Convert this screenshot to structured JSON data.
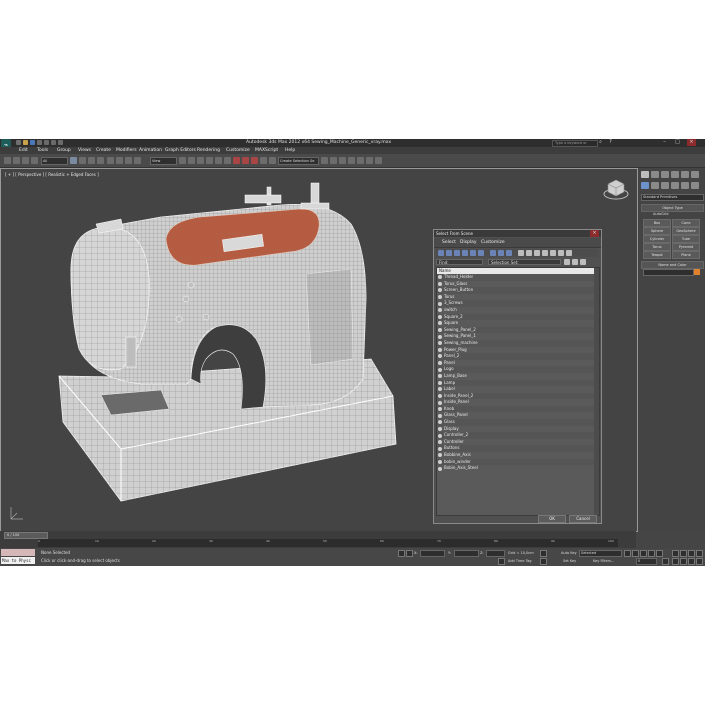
{
  "app": {
    "title": "Autodesk 3ds Max  2012 x64     Sewing_Machine_Generic_vray.max",
    "search_placeholder": "Type a keyword or phrase"
  },
  "menu": [
    "Edit",
    "Tools",
    "Group",
    "Views",
    "Create",
    "Modifiers",
    "Animation",
    "Graph Editors",
    "Rendering",
    "Customize",
    "MAXScript",
    "Help"
  ],
  "toolbar": {
    "filter": "All",
    "ref_coord": "View",
    "named_selection": "Create Selection Se"
  },
  "viewport": {
    "label": "[ + ] [ Perspective ] [ Realistic + Edged Faces ]"
  },
  "command_panel": {
    "category": "Standard Primitives",
    "object_type_header": "Object Type",
    "autogrid": "AutoGrid",
    "primitives": [
      "Box",
      "Cone",
      "Sphere",
      "GeoSphere",
      "Cylinder",
      "Tube",
      "Torus",
      "Pyramid",
      "Teapot",
      "Plane"
    ],
    "name_color_header": "Name and Color",
    "accent_color": "#e0822c"
  },
  "dialog": {
    "title": "Select From Scene",
    "menus": [
      "Select",
      "Display",
      "Customize"
    ],
    "find_label": "Find:",
    "selection_set_label": "Selection Set:",
    "column_header": "Name",
    "objects": [
      "Thread_Holder",
      "Torus_Glass",
      "Screen_Button",
      "Torus",
      "3_Screws",
      "switch",
      "Square_2",
      "Square",
      "Sewing_Panel_2",
      "Sewing_Panel_1",
      "Sewing_machine",
      "Power_Plug",
      "Panel_2",
      "Panel",
      "Logo",
      "Lamp_Base",
      "Lamp",
      "Label",
      "Inside_Panel_2",
      "Inside_Panel",
      "Knob",
      "Glass_Panel",
      "Glass",
      "Display",
      "Controller_2",
      "Controller",
      "Buttons",
      "Bobbine_Axis",
      "bobin_winder",
      "Bobin_Axis_Steel"
    ],
    "ok_label": "OK",
    "cancel_label": "Cancel"
  },
  "trackbar": {
    "time": "0 / 100",
    "tick_labels": [
      "0",
      "10",
      "20",
      "30",
      "40",
      "50",
      "60",
      "70",
      "80",
      "90",
      "100"
    ]
  },
  "status": {
    "maxscript_text": "Max to Physc",
    "selection_status": "None Selected",
    "prompt": "Click or click-and-drag to select objects",
    "x_label": "X:",
    "y_label": "Y:",
    "z_label": "Z:",
    "grid": "Grid = 10,0cm",
    "add_time_tag": "Add Time Tag",
    "auto_key": "Auto Key",
    "selected": "Selected",
    "set_key": "Set Key",
    "key_filters": "Key Filters...",
    "frame": "0"
  }
}
